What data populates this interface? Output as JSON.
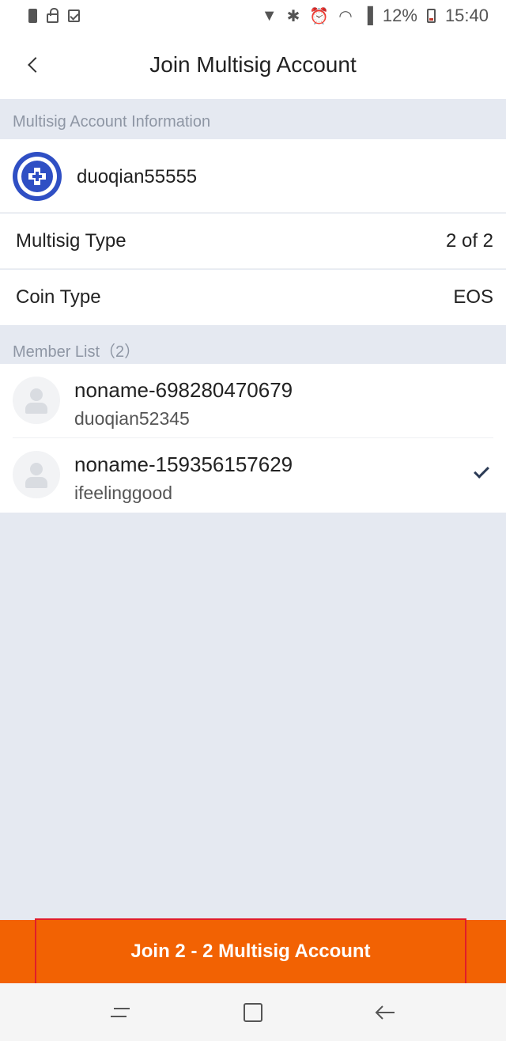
{
  "status_bar": {
    "battery_percent": "12%",
    "time": "15:40"
  },
  "header": {
    "title": "Join Multisig Account"
  },
  "account_info": {
    "section_label": "Multisig Account Information",
    "account_name": "duoqian55555",
    "multisig_type_label": "Multisig Type",
    "multisig_type_value": "2 of 2",
    "coin_type_label": "Coin Type",
    "coin_type_value": "EOS"
  },
  "members": {
    "section_label": "Member List（2）",
    "items": [
      {
        "name": "noname-698280470679",
        "account": "duoqian52345",
        "selected": false
      },
      {
        "name": "noname-159356157629",
        "account": "ifeelinggood",
        "selected": true
      }
    ]
  },
  "actions": {
    "join_label": "Join 2 - 2 Multisig Account"
  },
  "colors": {
    "accent": "#f26203",
    "page_background": "#e5e9f1",
    "logo_blue": "#2f4fc4"
  }
}
